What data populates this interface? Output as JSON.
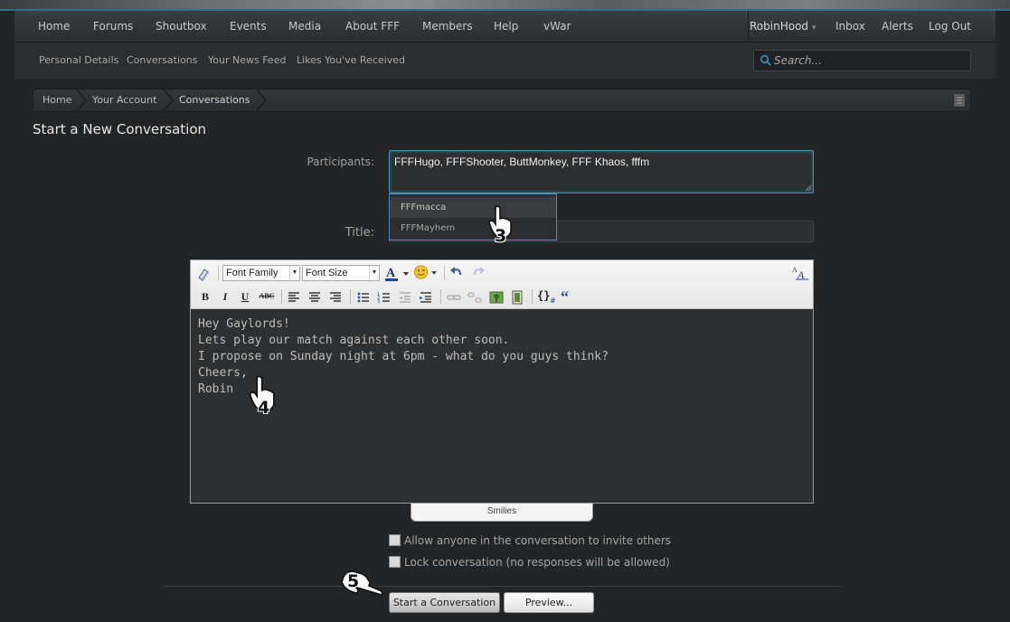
{
  "nav": {
    "items": [
      "Home",
      "Forums",
      "Shoutbox",
      "Events",
      "Media",
      "About FFF",
      "Members",
      "Help",
      "vWar"
    ],
    "user": "RobinHood",
    "right": [
      "Inbox",
      "Alerts",
      "Log Out"
    ]
  },
  "subnav": {
    "items": [
      "Personal Details",
      "Conversations",
      "Your News Feed",
      "Likes You've Received"
    ],
    "search_placeholder": "Search..."
  },
  "breadcrumb": [
    "Home",
    "Your Account",
    "Conversations"
  ],
  "page_title": "Start a New Conversation",
  "form": {
    "participants_label": "Participants:",
    "participants_value": "FFFHugo, FFFShooter, ButtMonkey, FFF Khaos, fffm",
    "suggestions": [
      "FFFmacca",
      "FFFMayhem"
    ],
    "title_label": "Title:",
    "title_value": ""
  },
  "editor": {
    "font_family": "Font Family",
    "font_size": "Font Size",
    "body_lines": [
      "Hey Gaylords!",
      "Lets play our match against each other soon.",
      "I propose on Sunday night at 6pm - what do you guys think?",
      "Cheers,",
      "Robin"
    ],
    "smilies_label": "Smilies"
  },
  "options": {
    "invite_label": "Allow anyone in the conversation to invite others",
    "lock_label": "Lock conversation (no responses will be allowed)"
  },
  "buttons": {
    "start": "Start a Conversation",
    "preview": "Preview..."
  },
  "annotations": [
    "3",
    "4",
    "5"
  ],
  "colors": {
    "accent": "#3f8fb6",
    "background": "#222426"
  }
}
